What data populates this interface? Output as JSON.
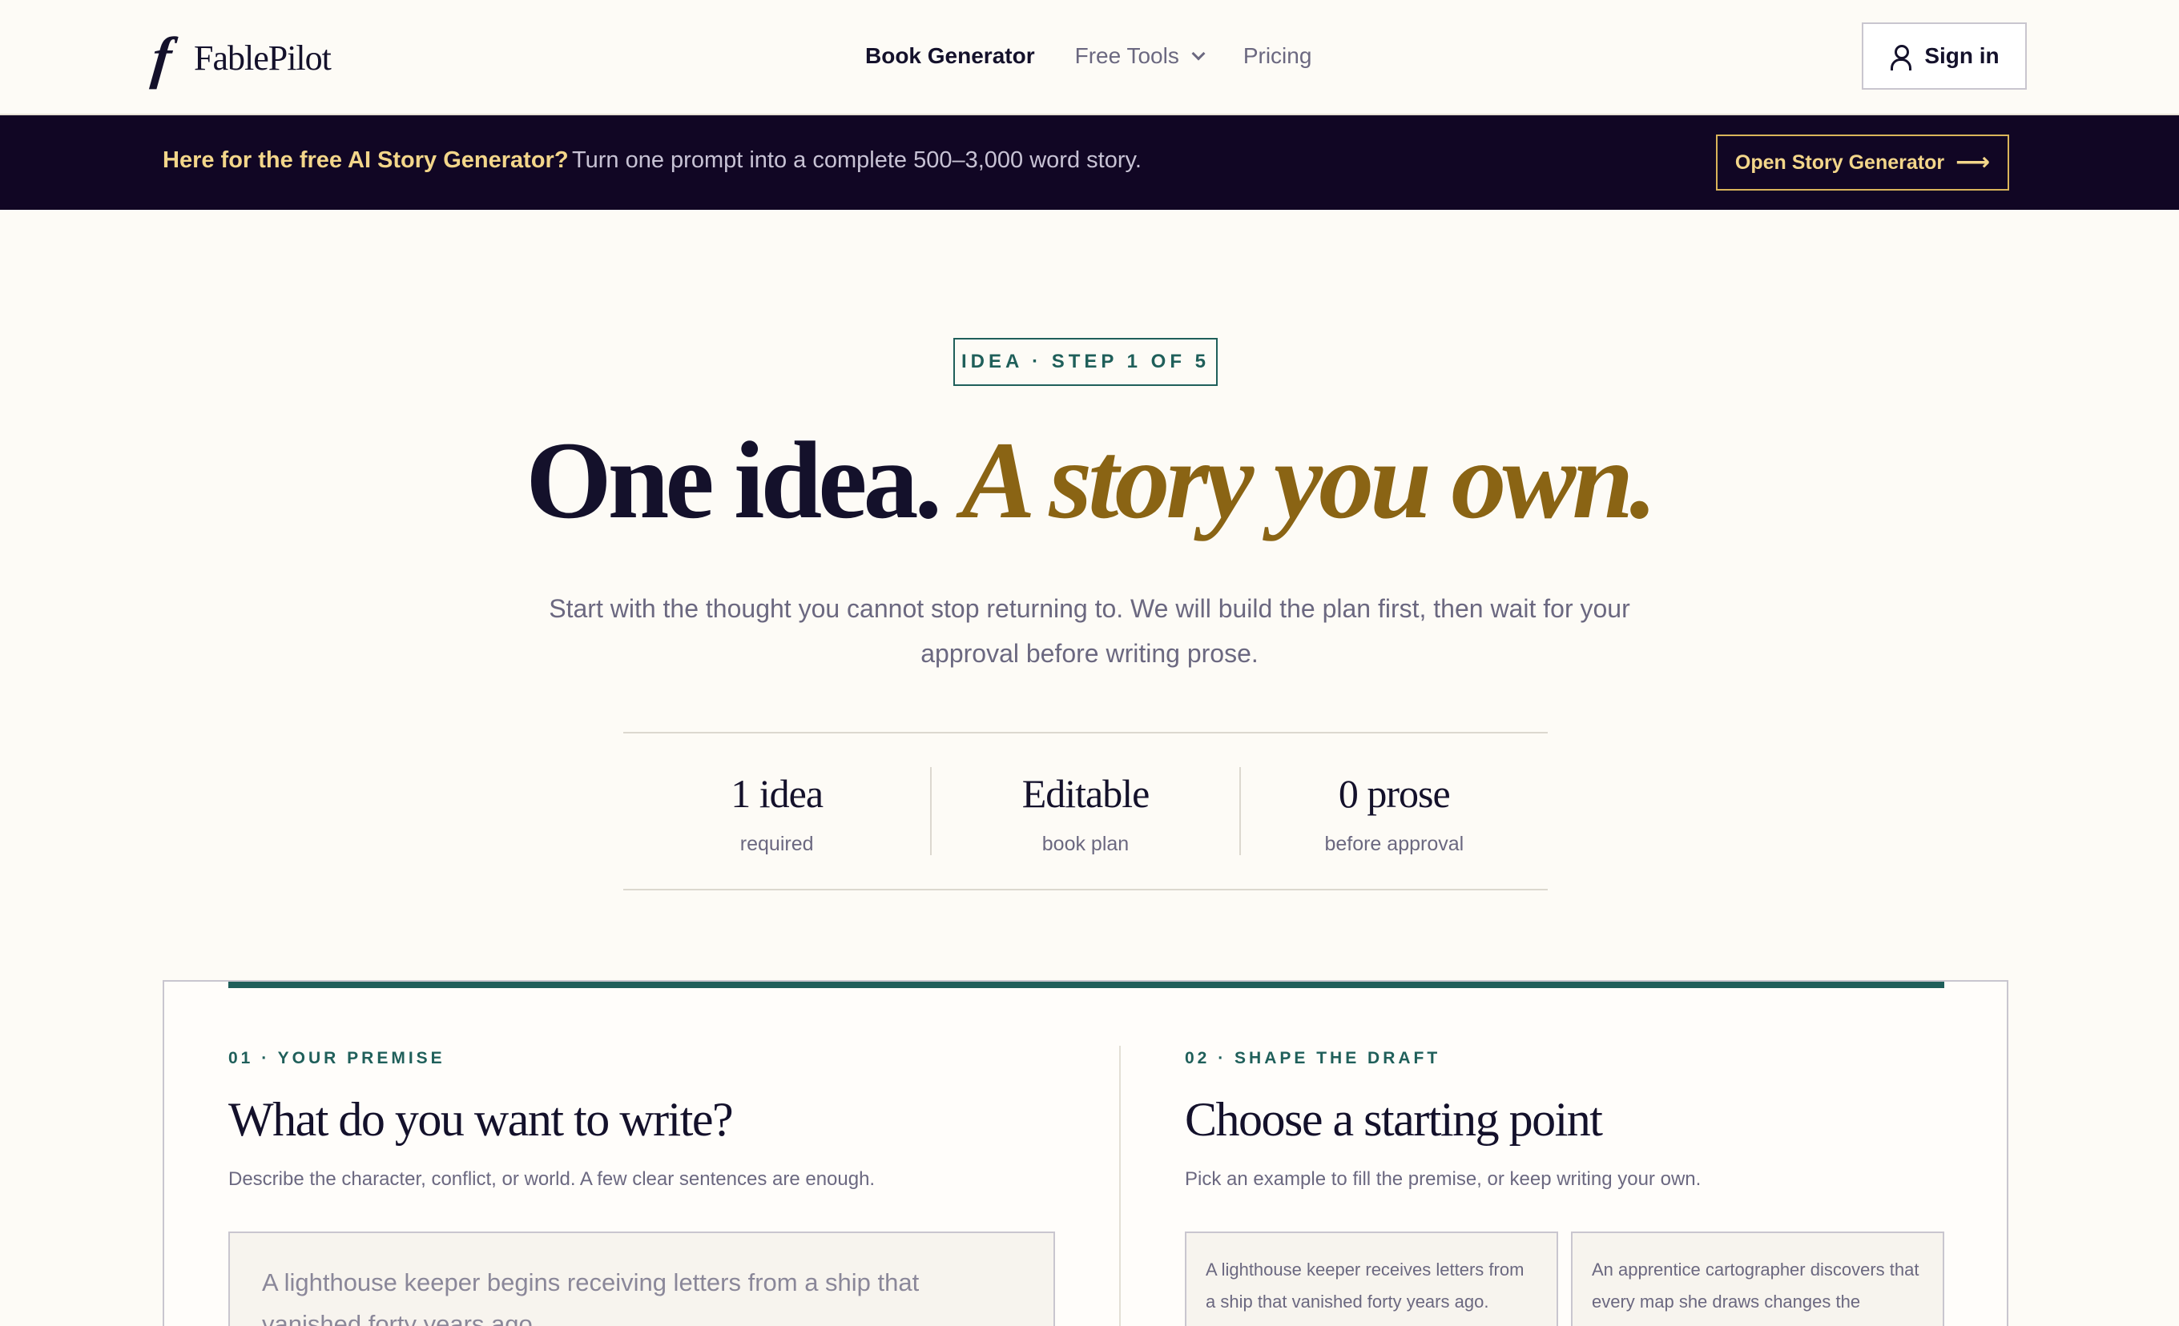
{
  "header": {
    "logo_mark": "f",
    "logo_text": "FablePilot",
    "nav": [
      {
        "label": "Book Generator",
        "active": true
      },
      {
        "label": "Free Tools",
        "has_dropdown": true
      },
      {
        "label": "Pricing"
      }
    ],
    "signin_label": "Sign in",
    "signin_icon": "user-icon"
  },
  "banner": {
    "lead": "Here for the free AI Story Generator?",
    "text": "Turn one prompt into a complete 500–3,000 word story.",
    "button_label": "Open Story Generator",
    "button_icon": "arrow-right-icon"
  },
  "hero": {
    "step_badge": "IDEA · STEP 1 OF 5",
    "title_main": "One idea.",
    "title_accent": "A story you own.",
    "subtitle": "Start with the thought you cannot stop returning to. We will build the plan first, then wait for your approval before writing prose."
  },
  "stats": [
    {
      "value": "1 idea",
      "label": "required"
    },
    {
      "value": "Editable",
      "label": "book plan"
    },
    {
      "value": "0 prose",
      "label": "before approval"
    }
  ],
  "premise": {
    "eyebrow": "01 · YOUR PREMISE",
    "title": "What do you want to write?",
    "description": "Describe the character, conflict, or world. A few clear sentences are enough.",
    "placeholder": "A lighthouse keeper begins receiving letters from a ship that vanished forty years ago."
  },
  "draft": {
    "eyebrow": "02 · SHAPE THE DRAFT",
    "title": "Choose a starting point",
    "description": "Pick an example to fill the premise, or keep writing your own.",
    "examples": [
      "A lighthouse keeper receives letters from a ship that vanished forty years ago.",
      "An apprentice cartographer discovers that every map she draws changes the kingdom."
    ]
  },
  "colors": {
    "background": "#fdfbf6",
    "ink": "#14112b",
    "banner_bg": "#110624",
    "gold": "#8a6414",
    "banner_gold": "#f3d68a",
    "teal": "#1f5f5a"
  }
}
